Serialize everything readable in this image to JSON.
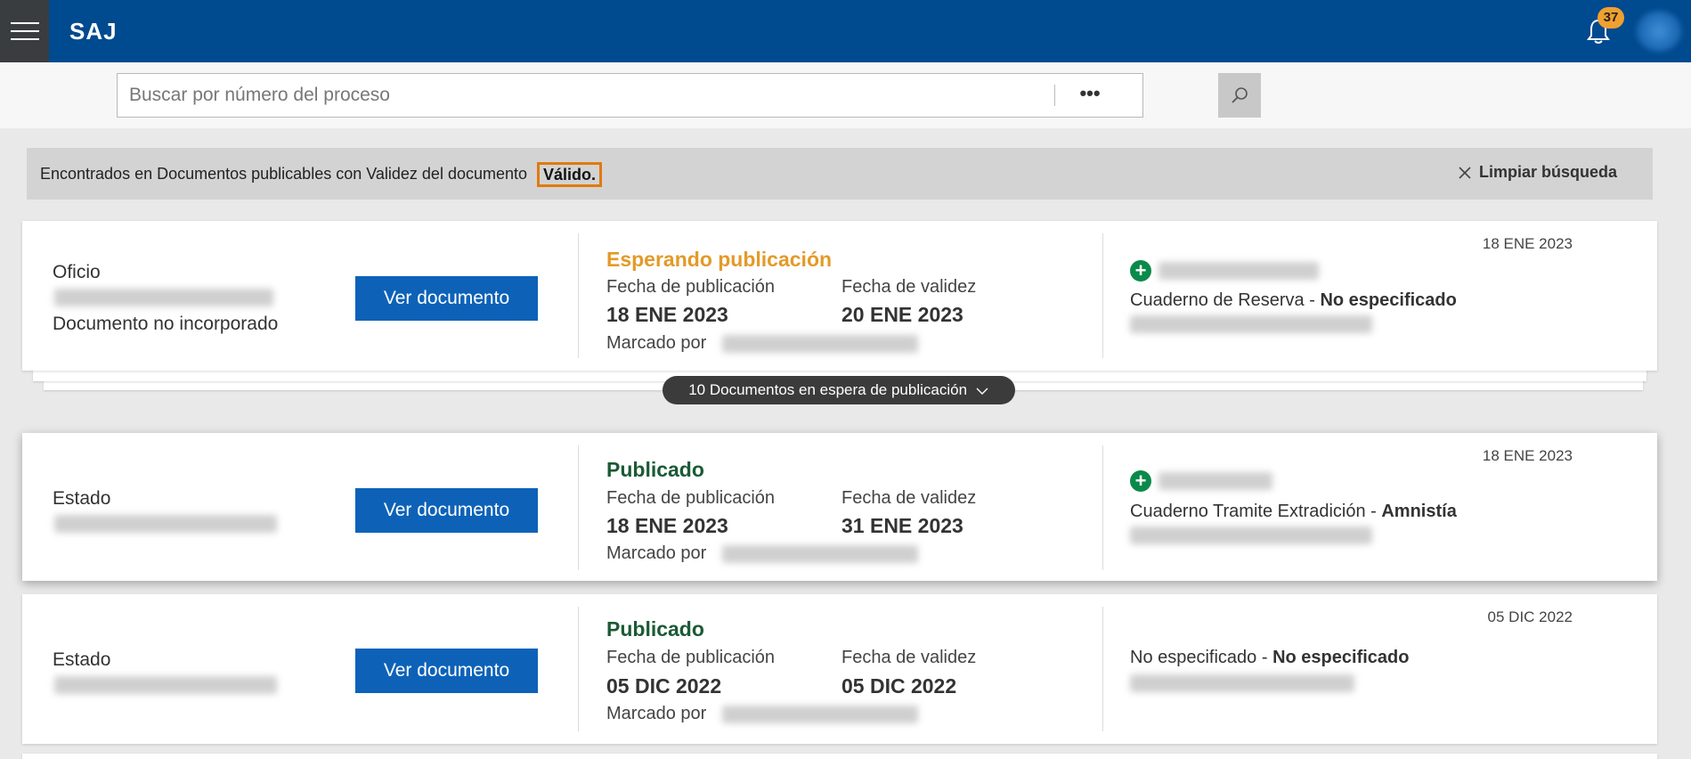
{
  "header": {
    "app_name": "SAJ",
    "notification_count": "37",
    "icons": {
      "menu": "hamburger-menu-icon",
      "notifications": "bell-icon",
      "avatar": "user-avatar"
    }
  },
  "search": {
    "placeholder": "Buscar por número del proceso",
    "value": "",
    "more_label": "•••"
  },
  "filter": {
    "text": "Encontrados en Documentos publicables con Validez del documento",
    "value": "Válido",
    "suffix": ".",
    "clear_label": "Limpiar búsqueda"
  },
  "colors": {
    "brand": "#004a8f",
    "button": "#0d62b8",
    "waiting": "#e39a28",
    "published": "#1a5a35",
    "highlight": "#e07a10",
    "add": "#0a8a4a"
  },
  "labels": {
    "ver_documento": "Ver documento",
    "fecha_publicacion": "Fecha de publicación",
    "fecha_validez": "Fecha de validez",
    "marcado_por": "Marcado por"
  },
  "stack_toggle": "10 Documentos en espera de publicación",
  "documents": [
    {
      "type": "Oficio",
      "note": "Documento no incorporado",
      "status": "Esperando publicación",
      "publication_date": "18 ENE 2023",
      "validity_date": "20 ENE 2023",
      "date": "18 ENE 2023",
      "cuaderno": "Cuaderno de Reserva",
      "cuaderno_value": "No especificado"
    },
    {
      "type": "Estado",
      "status": "Publicado",
      "publication_date": "18 ENE 2023",
      "validity_date": "31 ENE 2023",
      "date": "18 ENE 2023",
      "cuaderno": "Cuaderno Tramite Extradición",
      "cuaderno_value": "Amnistía"
    },
    {
      "type": "Estado",
      "status": "Publicado",
      "publication_date": "05 DIC 2022",
      "validity_date": "05 DIC 2022",
      "date": "05 DIC 2022",
      "cuaderno": "No especificado",
      "cuaderno_value": "No especificado"
    }
  ]
}
